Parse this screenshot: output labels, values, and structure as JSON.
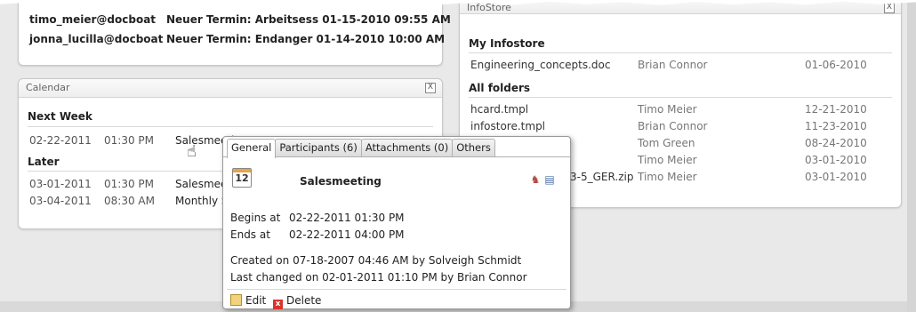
{
  "mail": {
    "items": [
      {
        "sender": "timo_meier@docboat",
        "subject": "Neuer Termin: Arbeitsess 01-15-2010 09:55 AM"
      },
      {
        "sender": "jonna_lucilla@docboat",
        "subject": "Neuer Termin: Endanger 01-14-2010 10:00 AM"
      }
    ]
  },
  "calendar": {
    "title": "Calendar",
    "close": "X",
    "next_week": {
      "heading": "Next Week",
      "rows": [
        {
          "date": "02-22-2011",
          "time": "01:30 PM",
          "title": "Salesmeeting"
        }
      ]
    },
    "later": {
      "heading": "Later",
      "rows": [
        {
          "date": "03-01-2011",
          "time": "01:30 PM",
          "title": "Salesmee"
        },
        {
          "date": "03-04-2011",
          "time": "08:30 AM",
          "title": "Monthly S"
        }
      ]
    }
  },
  "infostore": {
    "title": "InfoStore",
    "close": "X",
    "my": {
      "heading": "My Infostore",
      "rows": [
        {
          "name": "Engineering_concepts.doc",
          "owner": "Brian Connor",
          "date": "01-06-2010"
        }
      ]
    },
    "all": {
      "heading": "All folders",
      "rows": [
        {
          "name": "hcard.tmpl",
          "owner": "Timo Meier",
          "date": "12-21-2010"
        },
        {
          "name": "infostore.tmpl",
          "owner": "Brian Connor",
          "date": "11-23-2010"
        },
        {
          "name": "",
          "owner": "Tom Green",
          "date": "08-24-2010"
        },
        {
          "name": "",
          "owner": "Timo Meier",
          "date": "03-01-2010"
        },
        {
          "name": "3-5_GER.zip",
          "owner": "Timo Meier",
          "date": "03-01-2010"
        }
      ]
    }
  },
  "popup": {
    "tabs": [
      "General",
      "Participants (6)",
      "Attachments (0)",
      "Others"
    ],
    "cal_day": "12",
    "title": "Salesmeeting",
    "begins_label": "Begins at",
    "begins_value": "02-22-2011 01:30 PM",
    "ends_label": "Ends at",
    "ends_value": "02-22-2011 04:00 PM",
    "created": "Created on 07-18-2007 04:46 AM by Solveigh Schmidt",
    "changed": "Last changed on 02-01-2011 01:10 PM by Brian Connor",
    "edit": "Edit",
    "delete": "Delete"
  }
}
